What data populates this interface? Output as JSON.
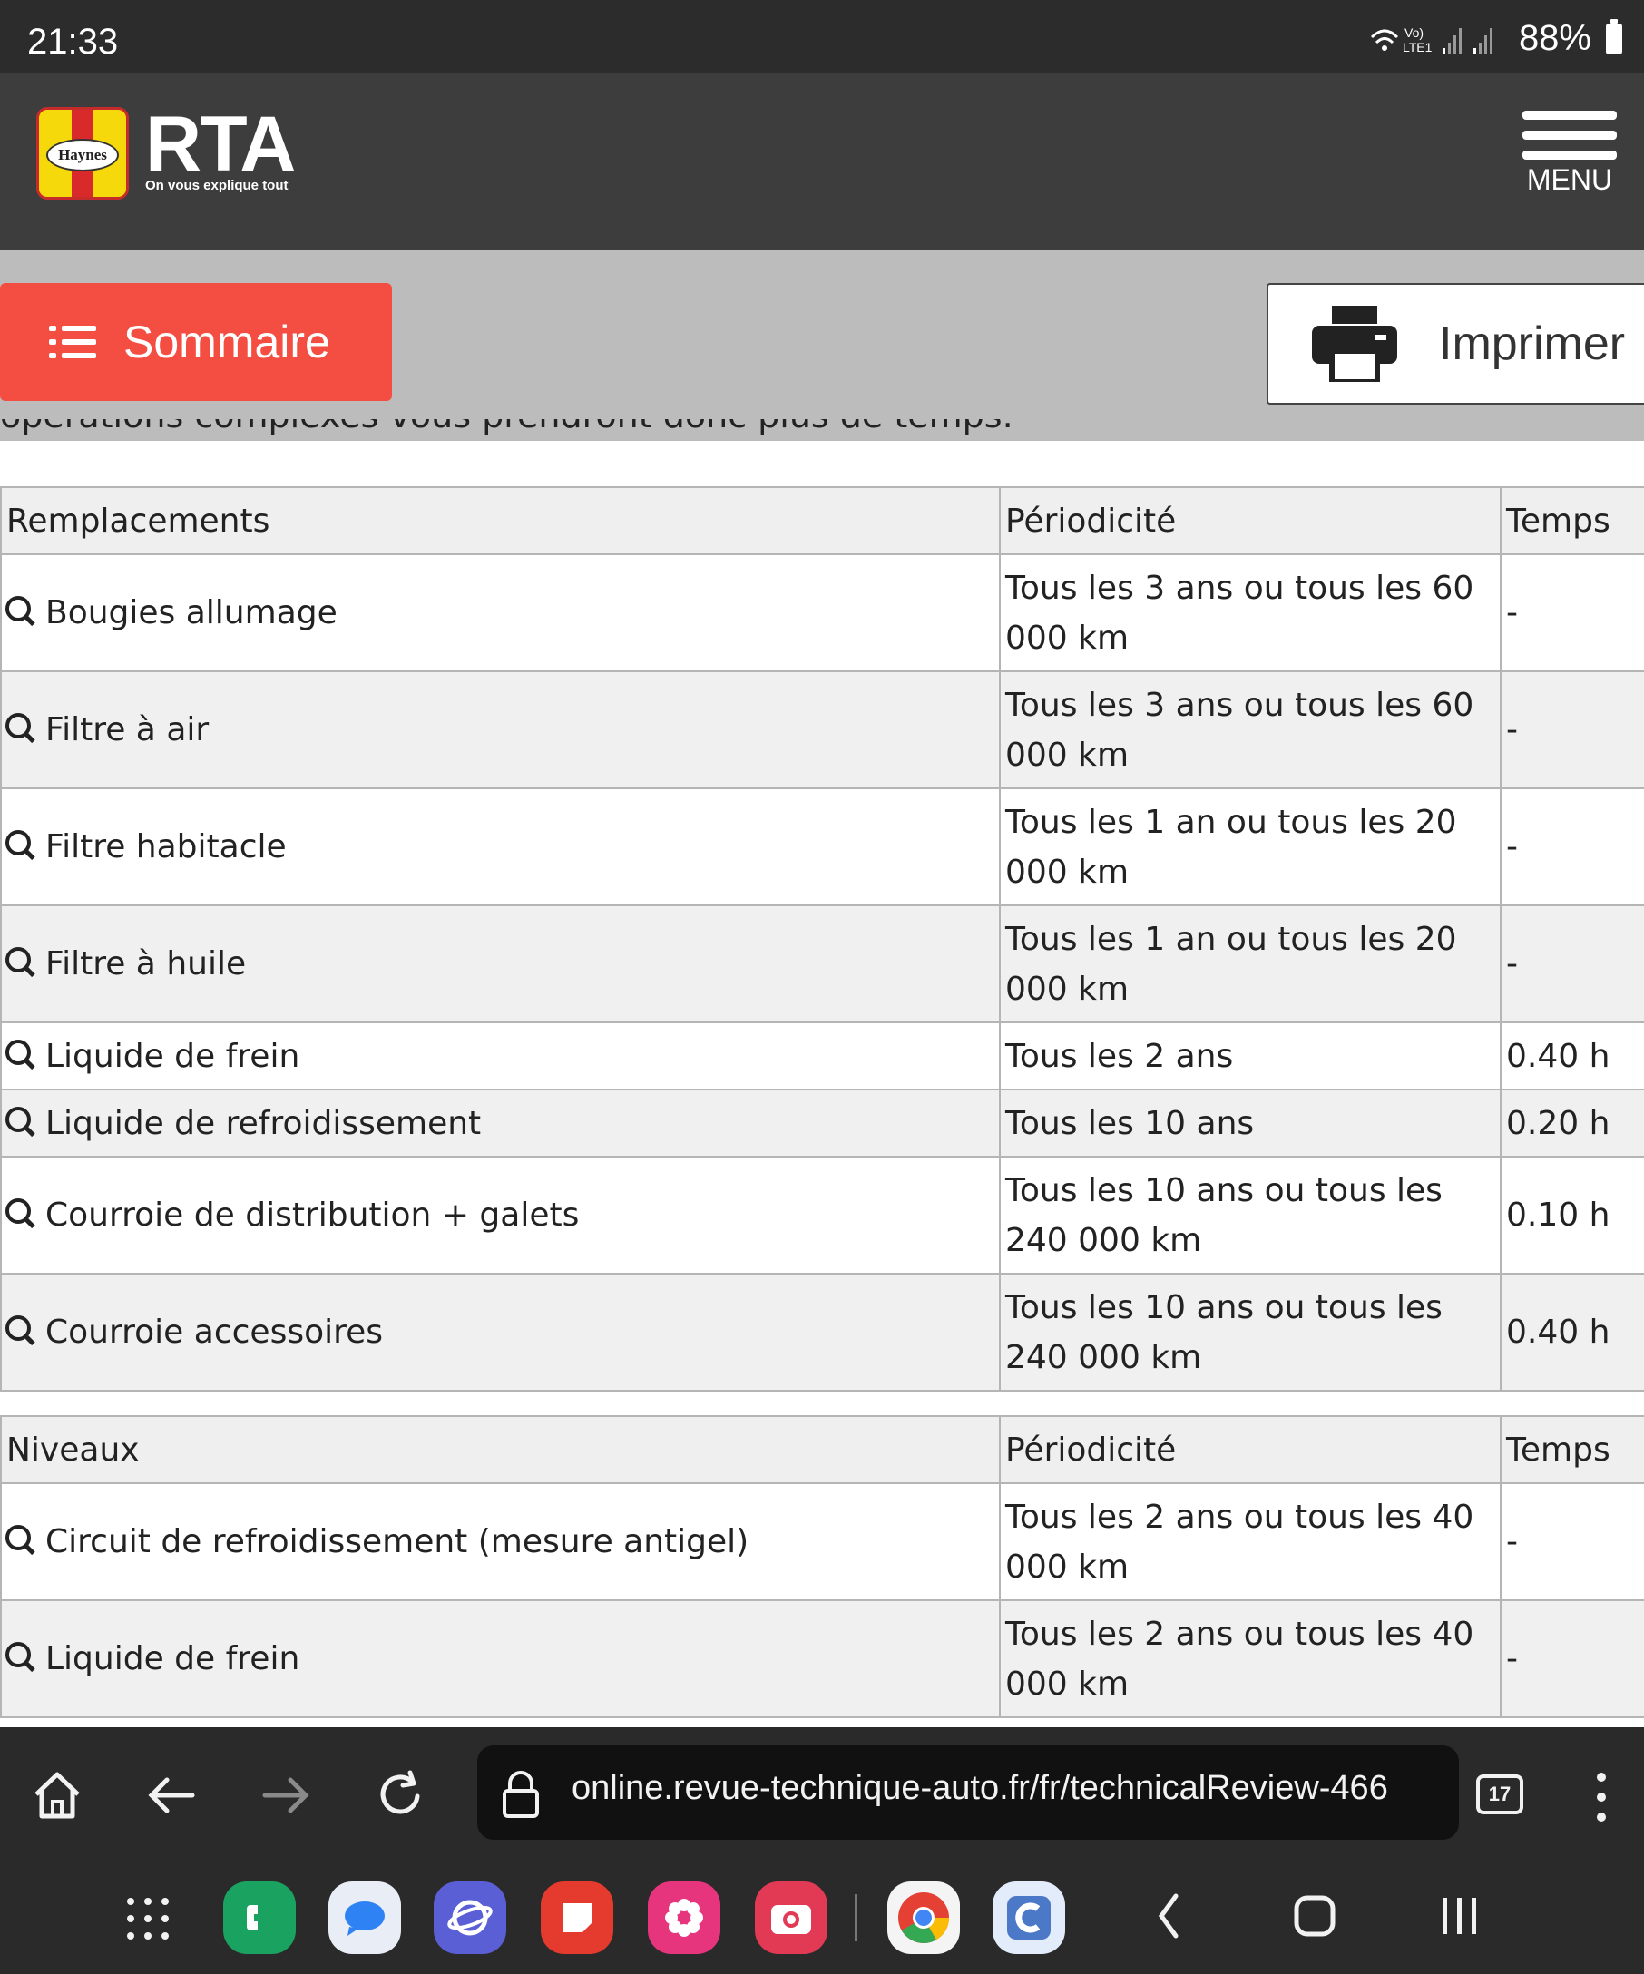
{
  "status_bar": {
    "time": "21:33",
    "indicators": "ὭC Vo) LTE1 .∣l .∣l",
    "battery": "88%"
  },
  "header": {
    "logo_haynes_text": "Haynes",
    "logo_name": "RTA",
    "logo_tagline": "On vous explique tout",
    "menu_label": "MENU"
  },
  "actions": {
    "sommaire_label": "Sommaire",
    "imprimer_label": "Imprimer"
  },
  "clipped_paragraph": "opérations complexes vous prendront donc plus de temps.",
  "remplacements": {
    "headers": [
      "Remplacements",
      "Périodicité",
      "Temps"
    ],
    "rows": [
      {
        "item": "Bougies allumage",
        "periodicite": "Tous les 3 ans ou tous les 60 000 km",
        "temps": "-"
      },
      {
        "item": "Filtre à air",
        "periodicite": "Tous les 3 ans ou tous les 60 000 km",
        "temps": "-"
      },
      {
        "item": "Filtre habitacle",
        "periodicite": "Tous les 1 an ou tous les 20 000 km",
        "temps": "-"
      },
      {
        "item": "Filtre à huile",
        "periodicite": "Tous les 1 an ou tous les 20 000 km",
        "temps": "-"
      },
      {
        "item": "Liquide de frein",
        "periodicite": "Tous les 2 ans",
        "temps": "0.40 h"
      },
      {
        "item": "Liquide de refroidissement",
        "periodicite": "Tous les 10 ans",
        "temps": "0.20 h"
      },
      {
        "item": "Courroie de distribution + galets",
        "periodicite": "Tous les 10 ans ou tous les 240 000 km",
        "temps": "0.10 h"
      },
      {
        "item": "Courroie accessoires",
        "periodicite": "Tous les 10 ans ou tous les 240 000 km",
        "temps": "0.40 h"
      }
    ]
  },
  "niveaux": {
    "headers": [
      "Niveaux",
      "Périodicité",
      "Temps"
    ],
    "rows": [
      {
        "item": "Circuit de refroidissement (mesure antigel)",
        "periodicite": "Tous les 2 ans ou tous les 40 000 km",
        "temps": "-"
      },
      {
        "item": "Liquide de frein",
        "periodicite": "Tous les 2 ans ou tous les 40 000 km",
        "temps": "-"
      }
    ]
  },
  "browser": {
    "url": "online.revue-technique-auto.fr/fr/technicalReview-466",
    "tab_count": "17"
  },
  "dock": {
    "apps": [
      {
        "icon": "phone-app-icon",
        "color": "#1aa260"
      },
      {
        "icon": "messages-app-icon",
        "color": "#2f82f4"
      },
      {
        "icon": "internet-app-icon",
        "color": "#5a5fd6"
      },
      {
        "icon": "notes-app-icon",
        "color": "#e53b2f"
      },
      {
        "icon": "flower-app-icon",
        "color": "#e6357d"
      },
      {
        "icon": "camera-app-icon",
        "color": "#e23a55"
      },
      {
        "icon": "chrome-app-icon",
        "color": "#ffffff"
      },
      {
        "icon": "c-app-icon",
        "color": "#4b79c8"
      }
    ]
  },
  "colors": {
    "accent_red": "#f44e42",
    "header_bg": "#3d3d3d",
    "band_bg": "#bcbcbc"
  }
}
